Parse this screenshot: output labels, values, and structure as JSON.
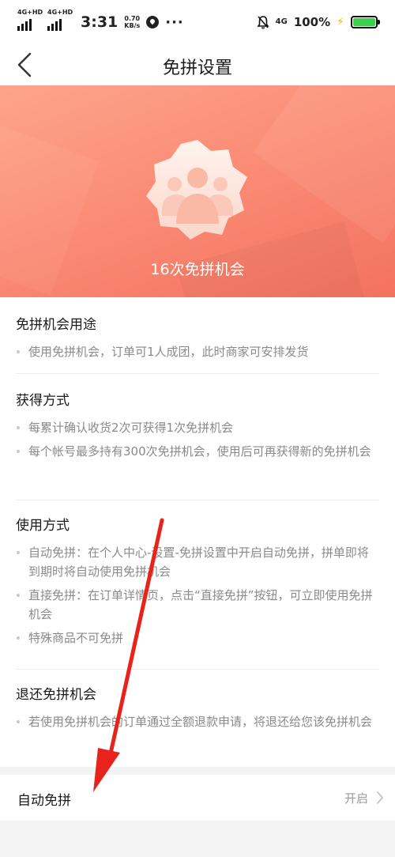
{
  "status_bar": {
    "network_1": "4G+HD",
    "network_2": "4G+HD",
    "time": "3:31",
    "speed_value": "0.70",
    "speed_unit": "KB/s",
    "network_right": "4G",
    "battery": "100%"
  },
  "nav": {
    "title": "免拼设置"
  },
  "hero": {
    "count_text": "16次免拼机会"
  },
  "sections": [
    {
      "title": "免拼机会用途",
      "items": [
        "使用免拼机会，订单可1人成团，此时商家可安排发货"
      ]
    },
    {
      "title": "获得方式",
      "items": [
        "每累计确认收货2次可获得1次免拼机会",
        "每个帐号最多持有300次免拼机会，使用后可再获得新的免拼机会"
      ]
    },
    {
      "title": "使用方式",
      "items": [
        "自动免拼：在个人中心-设置-免拼设置中开启自动免拼，拼单即将到期时将自动使用免拼机会",
        "直接免拼：在订单详情页，点击“直接免拼”按钮，可立即使用免拼机会",
        "特殊商品不可免拼"
      ]
    },
    {
      "title": "退还免拼机会",
      "items": [
        "若使用免拼机会的订单通过全额退款申请，将退还给您该免拼机会"
      ]
    }
  ],
  "auto_setting": {
    "label": "自动免拼",
    "value": "开启"
  },
  "colors": {
    "hero": "#fb8d76",
    "annotation": "#e8231c"
  },
  "icons": [
    "back-icon",
    "chevron-right-icon",
    "badge-icon",
    "people-icon"
  ]
}
